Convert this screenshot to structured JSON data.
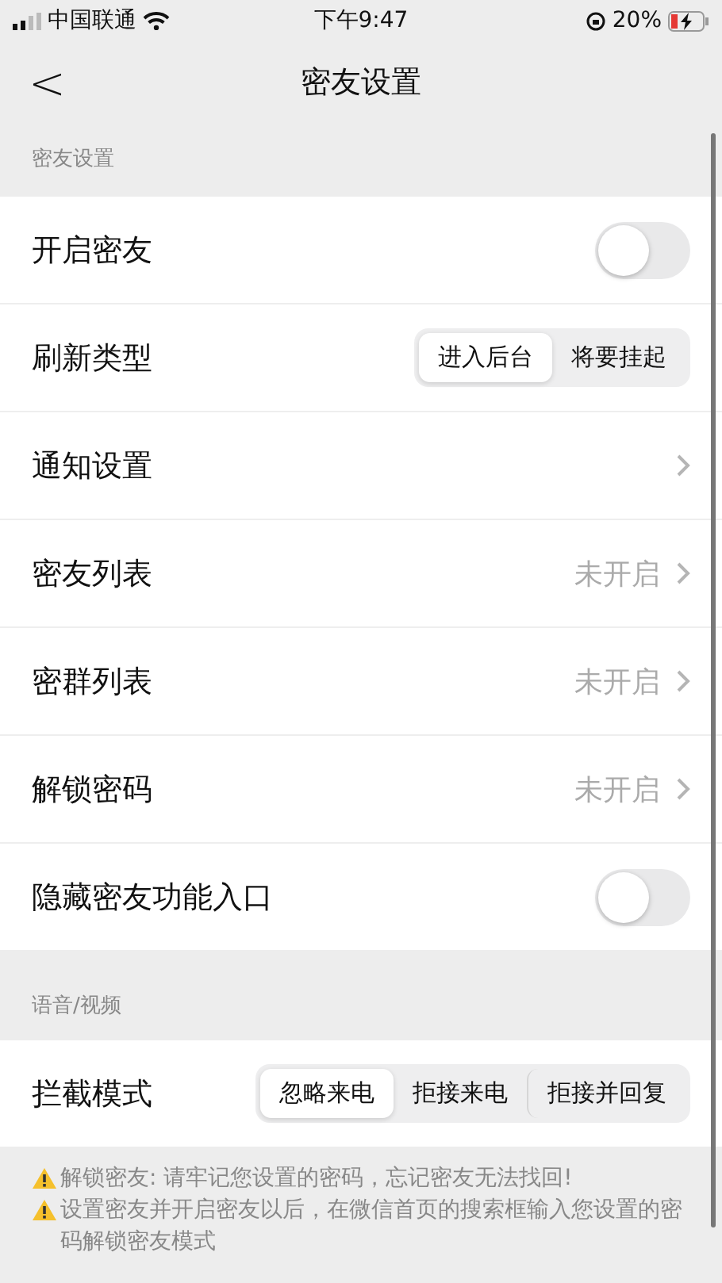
{
  "status_bar": {
    "carrier": "中国联通",
    "time": "下午9:47",
    "battery": "20%"
  },
  "nav": {
    "back": "<",
    "title": "密友设置"
  },
  "sections": [
    {
      "header": "密友设置",
      "rows": [
        {
          "kind": "toggle",
          "label": "开启密友",
          "on": false
        },
        {
          "kind": "segmented",
          "label": "刷新类型",
          "options": [
            {
              "label": "进入后台",
              "selected": true
            },
            {
              "label": "将要挂起",
              "selected": false
            }
          ]
        },
        {
          "kind": "link",
          "label": "通知设置"
        },
        {
          "kind": "link",
          "label": "密友列表",
          "value": "未开启"
        },
        {
          "kind": "link",
          "label": "密群列表",
          "value": "未开启"
        },
        {
          "kind": "link",
          "label": "解锁密码",
          "value": "未开启"
        },
        {
          "kind": "toggle",
          "label": "隐藏密友功能入口",
          "on": false
        }
      ]
    },
    {
      "header": "语音/视频",
      "rows": [
        {
          "kind": "segmented",
          "label": "拦截模式",
          "options": [
            {
              "label": "忽略来电",
              "selected": true
            },
            {
              "label": "拒接来电",
              "selected": false
            },
            {
              "label": "拒接并回复",
              "selected": false
            }
          ]
        }
      ]
    }
  ],
  "notes": [
    "解锁密友: 请牢记您设置的密码，忘记密友无法找回!",
    "设置密友并开启密友以后，在微信首页的搜索框输入您设置的密码解锁密友模式"
  ]
}
